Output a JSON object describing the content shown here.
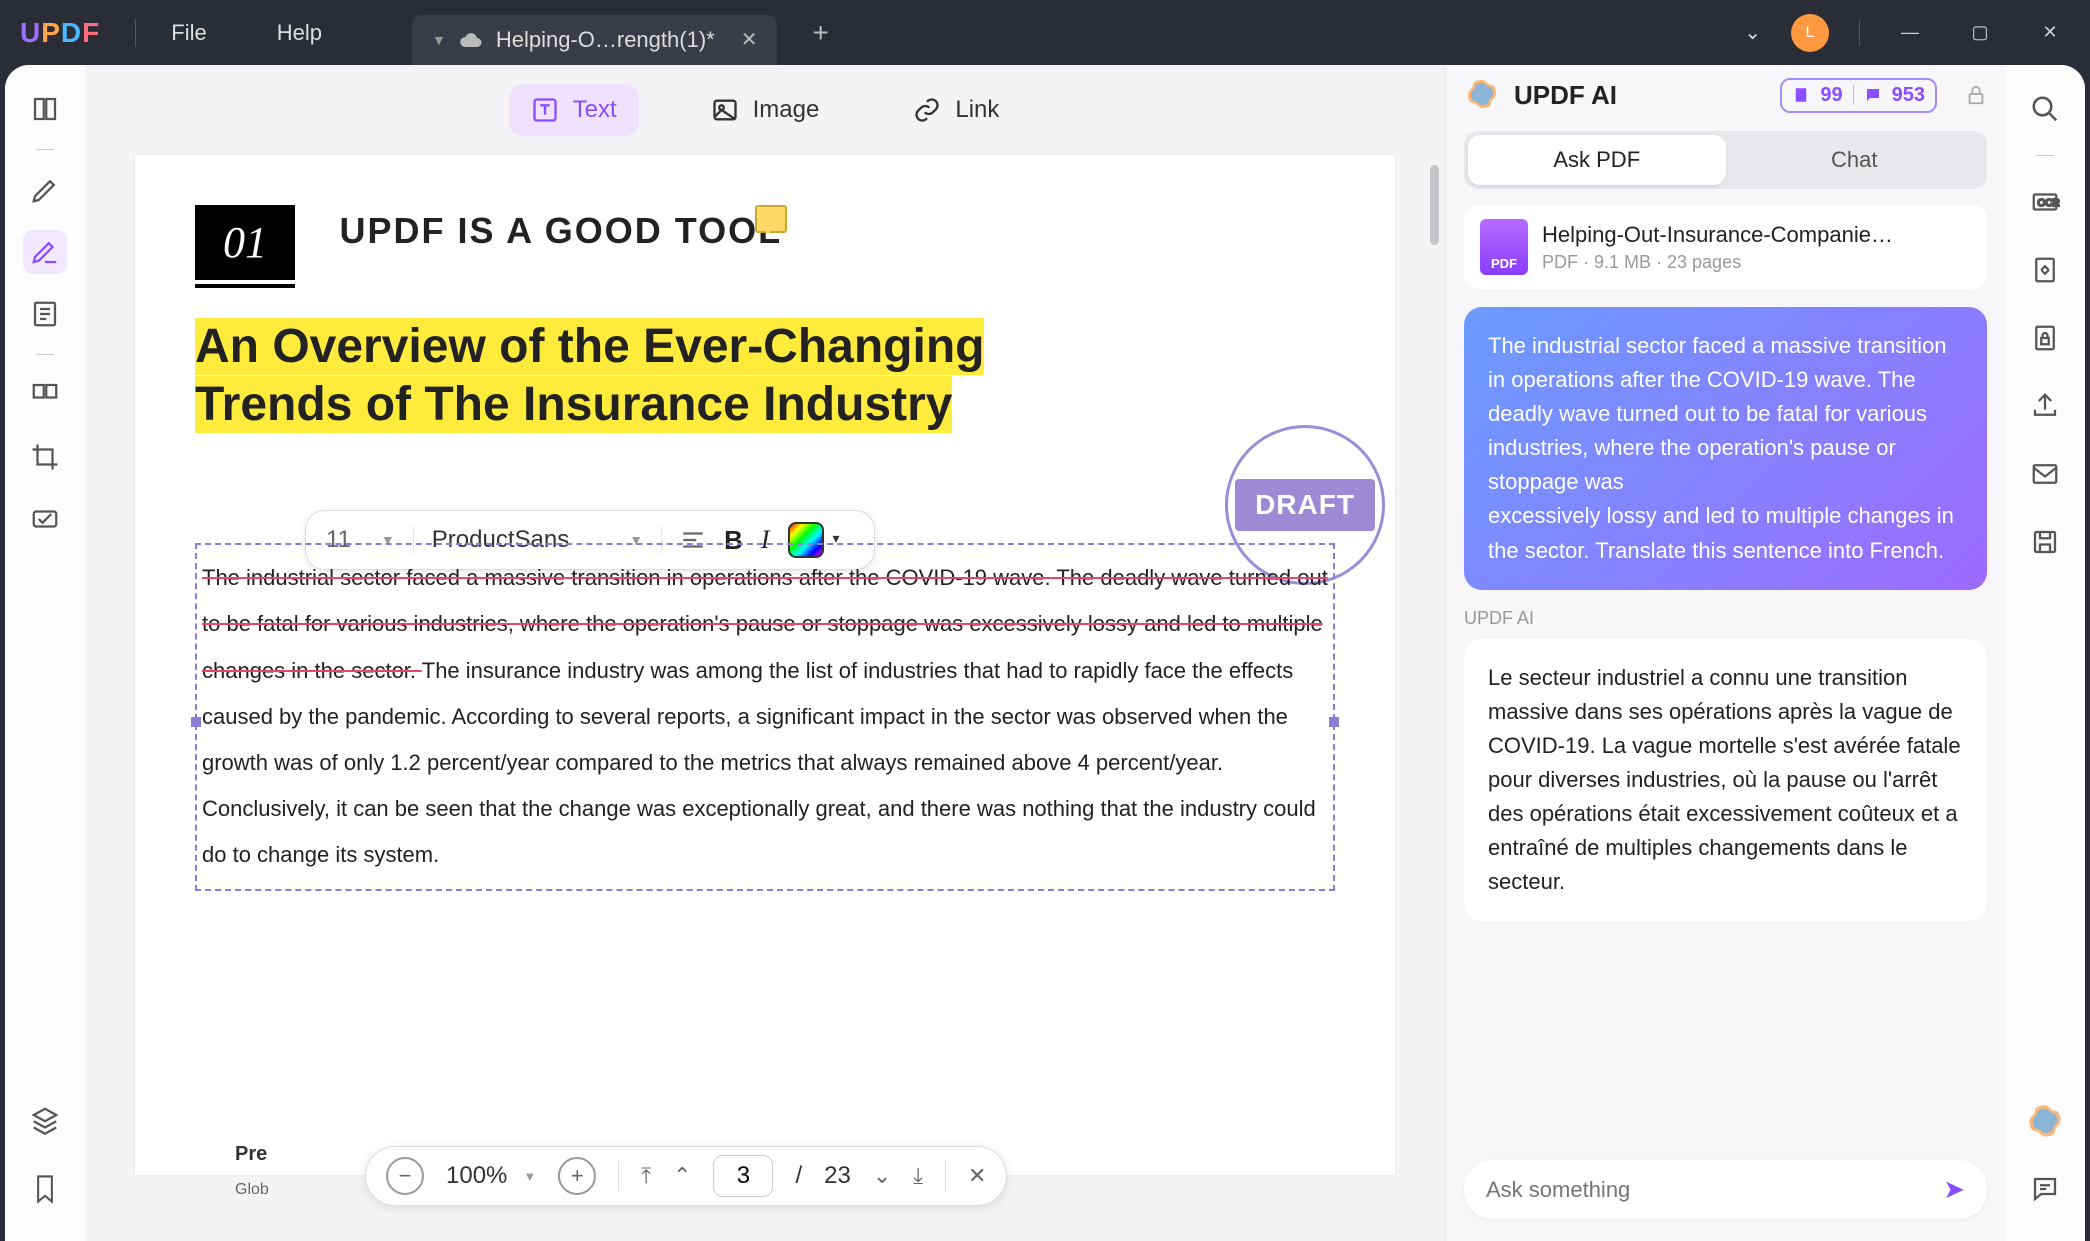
{
  "titlebar": {
    "file_menu": "File",
    "help_menu": "Help",
    "tab_title": "Helping-O…rength(1)*",
    "avatar_letter": "L"
  },
  "edit_toolbar": {
    "text": "Text",
    "image": "Image",
    "link": "Link"
  },
  "document": {
    "chapter_num": "01",
    "section_label": "UPDF IS A GOOD TOOL",
    "title_line1": "An Overview of the Ever-Changing",
    "title_line2": "Trends of The Insurance Industry",
    "stamp": "DRAFT",
    "body_struck": "The industrial sector faced a massive transition in operations after the COVID-19 wave. The deadly wave turned out to be fatal for various industries, where the operation's pause or stoppage was excessively lossy and led to multiple changes in the sector. ",
    "body_rest": "The insurance industry was among the list of industries that had to rapidly face the effects caused by the pandemic. According to several reports, a significant impact in the sector was observed when the growth was of only 1.2 percent/year compared to the metrics that always remained above 4 percent/year. Conclusively, it can be seen that the change was exceptionally great, and there was nothing that the industry could do to change its system.",
    "pre": "Pre",
    "glob": "Glob"
  },
  "format_bar": {
    "font_size": "11",
    "font_name": "ProductSans"
  },
  "page_nav": {
    "zoom": "100%",
    "current": "3",
    "sep": "/",
    "total": "23"
  },
  "ai": {
    "title": "UPDF AI",
    "count1": "99",
    "count2": "953",
    "tab_ask": "Ask PDF",
    "tab_chat": "Chat",
    "file_name": "Helping-Out-Insurance-Companie…",
    "file_meta": "PDF · 9.1 MB · 23 pages",
    "file_badge": "PDF",
    "user_message": "The industrial sector faced a massive transition in operations after the COVID-19 wave. The deadly wave turned out to be fatal for various industries, where the operation's pause or stoppage was\nexcessively lossy and led to multiple changes in the sector.  Translate this sentence into French.",
    "ai_label": "UPDF AI",
    "ai_message": "Le secteur industriel a connu une transition massive dans ses opérations après la vague de COVID-19. La vague mortelle s'est avérée fatale pour diverses industries, où la pause ou l'arrêt des opérations était excessivement coûteux et a entraîné de multiples changements dans le secteur.",
    "input_placeholder": "Ask something"
  }
}
